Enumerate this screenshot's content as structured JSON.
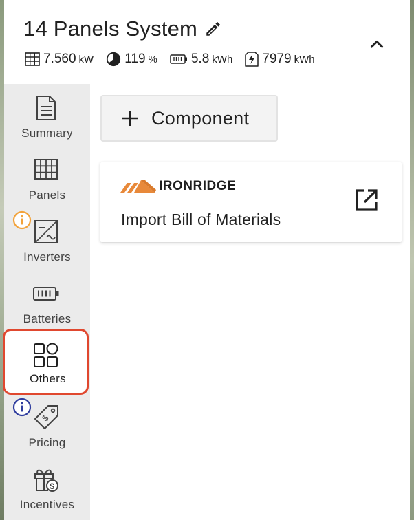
{
  "header": {
    "title": "14 Panels System",
    "stats": [
      {
        "icon": "solar-panel-icon",
        "value": "7.560",
        "unit": "kW"
      },
      {
        "icon": "offset-pie-icon",
        "value": "119",
        "unit": "%"
      },
      {
        "icon": "battery-icon",
        "value": "5.8",
        "unit": "kWh"
      },
      {
        "icon": "energy-production-icon",
        "value": "7979",
        "unit": "kWh"
      }
    ]
  },
  "sidebar": {
    "items": [
      {
        "label": "Summary",
        "icon": "document-icon"
      },
      {
        "label": "Panels",
        "icon": "panel-grid-icon"
      },
      {
        "label": "Inverters",
        "icon": "inverter-icon"
      },
      {
        "label": "Batteries",
        "icon": "battery-icon"
      },
      {
        "label": "Others",
        "icon": "shapes-icon",
        "active": true
      },
      {
        "label": "Pricing",
        "icon": "price-tag-icon"
      },
      {
        "label": "Incentives",
        "icon": "gift-dollar-icon"
      }
    ]
  },
  "main": {
    "add_button_label": "Component",
    "card": {
      "brand": "IRONRIDGE",
      "label": "Import Bill of Materials"
    }
  },
  "colors": {
    "active_border": "#e0482f",
    "warning_badge": "#f2a23a",
    "info_badge": "#2f3d9e",
    "brand_orange": "#e8893a"
  }
}
